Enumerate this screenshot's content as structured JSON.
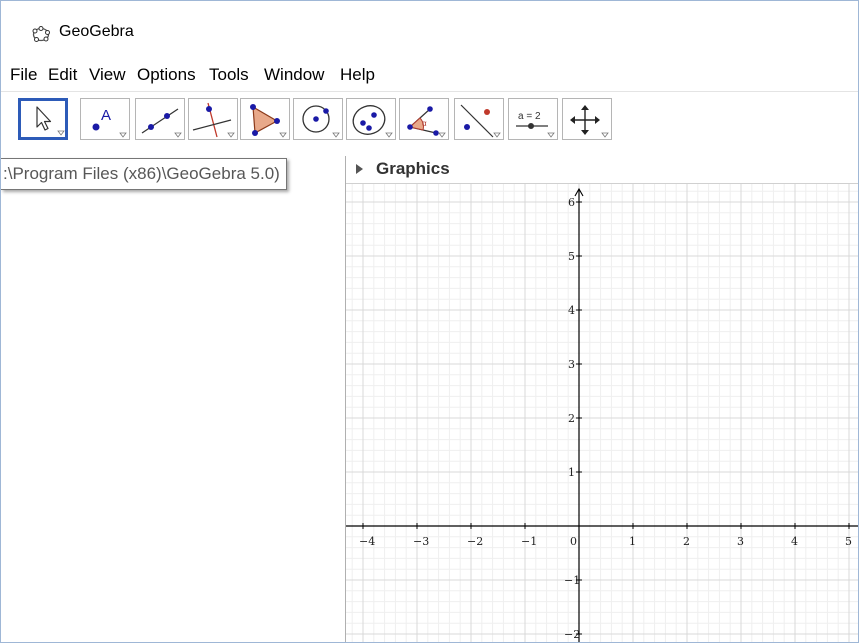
{
  "app": {
    "title": "GeoGebra",
    "accent_color": "#2d5bb8"
  },
  "menubar": {
    "items": [
      {
        "id": "file",
        "label": "File"
      },
      {
        "id": "edit",
        "label": "Edit"
      },
      {
        "id": "view",
        "label": "View"
      },
      {
        "id": "options",
        "label": "Options"
      },
      {
        "id": "tools",
        "label": "Tools"
      },
      {
        "id": "window",
        "label": "Window"
      },
      {
        "id": "help",
        "label": "Help"
      }
    ]
  },
  "toolbar": {
    "tools": [
      {
        "icon": "move-arrow-icon",
        "selected": true
      },
      {
        "icon": "point-icon",
        "label": "A"
      },
      {
        "icon": "line-icon"
      },
      {
        "icon": "perpendicular-line-icon"
      },
      {
        "icon": "polygon-icon"
      },
      {
        "icon": "circle-center-point-icon"
      },
      {
        "icon": "conic-ellipse-icon"
      },
      {
        "icon": "angle-icon",
        "label": "α"
      },
      {
        "icon": "reflect-about-line-icon"
      },
      {
        "icon": "slider-icon",
        "label": "a = 2"
      },
      {
        "icon": "move-graphics-view-icon"
      }
    ]
  },
  "tooltip": {
    "text": ":\\Program Files (x86)\\GeoGebra 5.0)"
  },
  "graphics": {
    "title": "Graphics",
    "x_ticks": [
      "−4",
      "−3",
      "−2",
      "−1",
      "0",
      "1",
      "2",
      "3",
      "4",
      "5"
    ],
    "y_ticks": [
      "6",
      "5",
      "4",
      "3",
      "2",
      "1",
      "−1",
      "−2"
    ],
    "grid_color": "#d9d9d9",
    "axis_color": "#000000"
  }
}
